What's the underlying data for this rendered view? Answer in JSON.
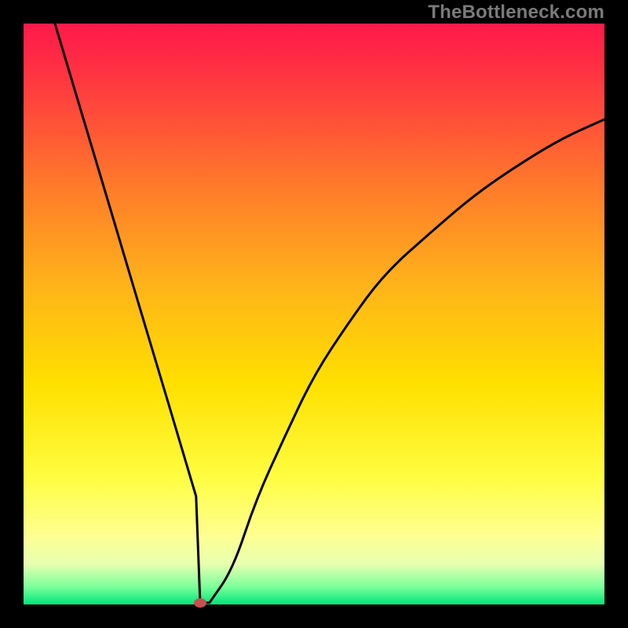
{
  "watermark": "TheBottleneck.com",
  "colors": {
    "frame": "#000000",
    "curve": "#000000",
    "marker": "#c94f4f"
  },
  "chart_data": {
    "type": "line",
    "title": "",
    "xlabel": "",
    "ylabel": "",
    "xlim": [
      0,
      1
    ],
    "ylim": [
      0,
      1
    ],
    "grid": false,
    "legend": false,
    "note": "V-shaped bottleneck curve: steep linear descent from top-left to the minimum, then an asymptotic rise toward the right. Values are fractions of the plot area (x right, y up).",
    "series": [
      {
        "name": "bottleneck-curve",
        "x": [
          0.054,
          0.1,
          0.15,
          0.2,
          0.25,
          0.297,
          0.304,
          0.32,
          0.36,
          0.4,
          0.45,
          0.5,
          0.56,
          0.62,
          0.7,
          0.78,
          0.86,
          0.93,
          1.0
        ],
        "y": [
          1.0,
          0.846,
          0.679,
          0.511,
          0.344,
          0.186,
          0.003,
          0.003,
          0.06,
          0.18,
          0.29,
          0.395,
          0.486,
          0.568,
          0.64,
          0.708,
          0.762,
          0.804,
          0.835,
          0.861
        ]
      }
    ],
    "marker": {
      "x": 0.304,
      "y": 0.003
    }
  }
}
